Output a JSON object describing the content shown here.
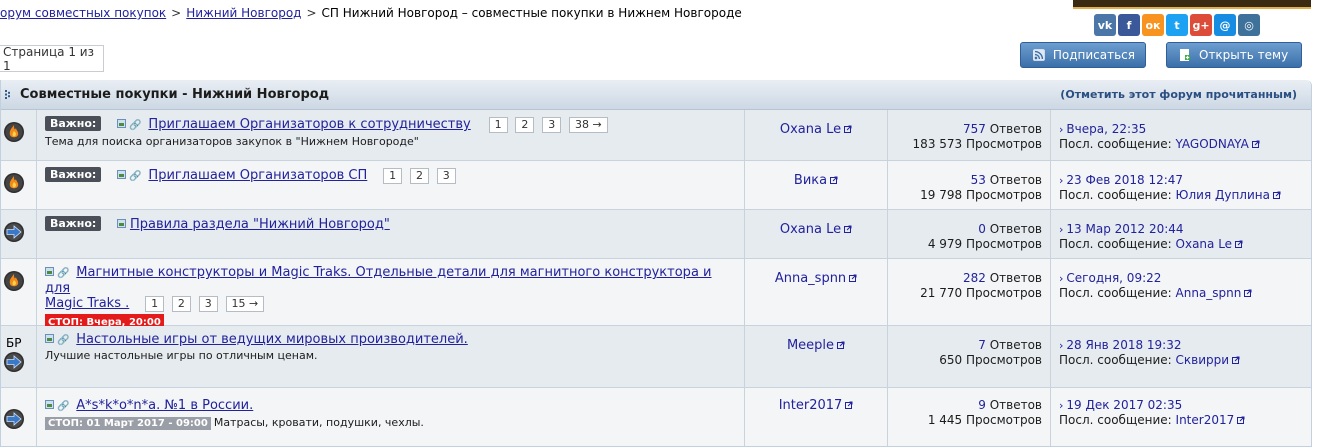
{
  "breadcrumb": {
    "items": [
      "орум совместных покупок",
      "Нижний Новгород"
    ],
    "separator": ">",
    "current": "СП Нижний Новгород – совместные покупки в Нижнем Новгороде"
  },
  "social": [
    {
      "name": "vk",
      "label": "vk",
      "color": "#4a76a8"
    },
    {
      "name": "facebook",
      "label": "f",
      "color": "#3b5998"
    },
    {
      "name": "odnoklassniki",
      "label": "ок",
      "color": "#f7931e"
    },
    {
      "name": "twitter",
      "label": "t",
      "color": "#1da1f2"
    },
    {
      "name": "google-plus",
      "label": "g+",
      "color": "#dd4b39"
    },
    {
      "name": "mail",
      "label": "@",
      "color": "#168de2"
    },
    {
      "name": "instagram",
      "label": "◎",
      "color": "#3f729b"
    }
  ],
  "pager": "Страница 1 из 1",
  "buttons": {
    "subscribe": "Подписаться",
    "new_topic": "Открыть тему"
  },
  "forum": {
    "title": "Совместные покупки - Нижний Новгород",
    "mark_read": "(Отметить этот форум прочитанным)"
  },
  "labels": {
    "important": "Важно:",
    "replies": "Ответов",
    "views": "Просмотров",
    "last_post": "Посл. сообщение:"
  },
  "topics": [
    {
      "icon": "hot",
      "important": true,
      "title": "Приглашаем Организаторов к сотрудничеству",
      "pages": [
        "1",
        "2",
        "3",
        "38 →"
      ],
      "description": "Тема для поиска организаторов закупок в \"Нижнем Новгороде\"",
      "author": "Oxana Le",
      "replies": "757",
      "views": "183 573",
      "last_date": "Вчера, 22:35",
      "last_author": "YAGODNAYA"
    },
    {
      "icon": "hot",
      "important": true,
      "title": "Приглашаем Организаторов СП",
      "pages": [
        "1",
        "2",
        "3"
      ],
      "author": "Вика",
      "replies": "53",
      "views": "19 798",
      "last_date": "23 Фев 2018 12:47",
      "last_author": "Юлия Дуплина"
    },
    {
      "icon": "arrow",
      "important": true,
      "title": "Правила раздела \"Нижний Новгород\"",
      "author": "Oxana Le",
      "replies": "0",
      "views": "4 979",
      "last_date": "13 Мар 2012 20:44",
      "last_author": "Oxana Le"
    },
    {
      "icon": "hot",
      "title_line1": "Магнитные конструкторы и Magic Traks. Отдельные детали для магнитного конструктора и для",
      "title_line2": "Magic Traks .",
      "pages": [
        "1",
        "2",
        "3",
        "15 →"
      ],
      "stop": "СТОП: Вчера, 20:00",
      "author": "Anna_spnn",
      "replies": "282",
      "views": "21 770",
      "last_date": "Сегодня, 09:22",
      "last_author": "Anna_spnn"
    },
    {
      "icon": "arrow",
      "prefix": "БР",
      "title": "Настольные игры от ведущих мировых производителей.",
      "description": "Лучшие настольные игры по отличным ценам.",
      "author": "Meeple",
      "replies": "7",
      "views": "650",
      "last_date": "28 Янв 2018 19:32",
      "last_author": "Сквирри"
    },
    {
      "icon": "arrow",
      "title": "А*s*k*o*n*а. №1 в России.",
      "stop": "СТОП: 01 Март 2017 - 09:00",
      "description": "Матрасы, кровати, подушки, чехлы.",
      "author": "Inter2017",
      "replies": "9",
      "views": "1 445",
      "last_date": "19 Дек 2017 02:35",
      "last_author": "Inter2017"
    }
  ]
}
